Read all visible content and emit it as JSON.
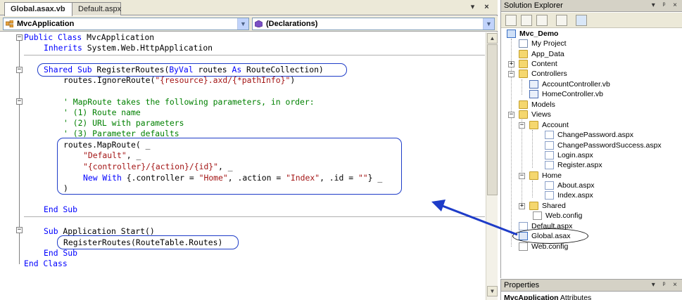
{
  "tabs": [
    {
      "label": "Global.asax.vb",
      "active": true
    },
    {
      "label": "Default.aspx",
      "active": false
    }
  ],
  "tab_buttons": {
    "nav": "▾",
    "close": "×"
  },
  "dropdowns": {
    "class_combo": "MvcApplication",
    "members_combo": "(Declarations)"
  },
  "code": {
    "l1": {
      "kw": "Public Class",
      "rest": " MvcApplication"
    },
    "l2": {
      "kw": "Inherits",
      "rest": " System.Web.HttpApplication"
    },
    "l3": {
      "kw": "Shared Sub",
      "name": " RegisterRoutes(",
      "kw2": "ByVal",
      "mid": " routes ",
      "kw3": "As",
      "rest": " RouteCollection)"
    },
    "l4": {
      "pre": "routes.IgnoreRoute(",
      "str": "\"{resource}.axd/{*pathInfo}\"",
      "post": ")"
    },
    "l5": "' MapRoute takes the following parameters, in order:",
    "l6": "' (1) Route name",
    "l7": "' (2) URL with parameters",
    "l8": "' (3) Parameter defaults",
    "l9": "routes.MapRoute( _",
    "l10": {
      "str": "\"Default\"",
      "post": ", _"
    },
    "l11": {
      "str": "\"{controller}/{action}/{id}\"",
      "post": ", _"
    },
    "l12": {
      "kw": "New With",
      "a": " {.controller = ",
      "s1": "\"Home\"",
      "b": ", .action = ",
      "s2": "\"Index\"",
      "c": ", .id = ",
      "s3": "\"\"",
      "d": "} _"
    },
    "l13": ")",
    "l14": "End Sub",
    "l15": {
      "kw": "Sub",
      "rest": " Application_Start()"
    },
    "l16": "RegisterRoutes(RouteTable.Routes)",
    "l17": "End Sub",
    "l18": "End Class"
  },
  "solution_explorer": {
    "title": "Solution Explorer",
    "pane_buttons": "▾ ᵖ ×",
    "items": {
      "project": "Mvc_Demo",
      "my_project": "My Project",
      "app_data": "App_Data",
      "content": "Content",
      "controllers": "Controllers",
      "account_controller": "AccountController.vb",
      "home_controller": "HomeController.vb",
      "models": "Models",
      "views": "Views",
      "account": "Account",
      "change_password": "ChangePassword.aspx",
      "change_password_success": "ChangePasswordSuccess.aspx",
      "login": "Login.aspx",
      "register": "Register.aspx",
      "home": "Home",
      "about": "About.aspx",
      "index": "Index.aspx",
      "shared": "Shared",
      "views_web_config": "Web.config",
      "default_aspx": "Default.aspx",
      "global_asax": "Global.asax",
      "web_config": "Web.config"
    }
  },
  "properties": {
    "title": "Properties",
    "pane_buttons": "▾ ᵖ ×",
    "object": "MvcApplication",
    "object_type": " Attributes"
  },
  "colors": {
    "keyword": "#0000ff",
    "string": "#a31515",
    "comment": "#008000",
    "annotation": "#1e3cc8"
  }
}
